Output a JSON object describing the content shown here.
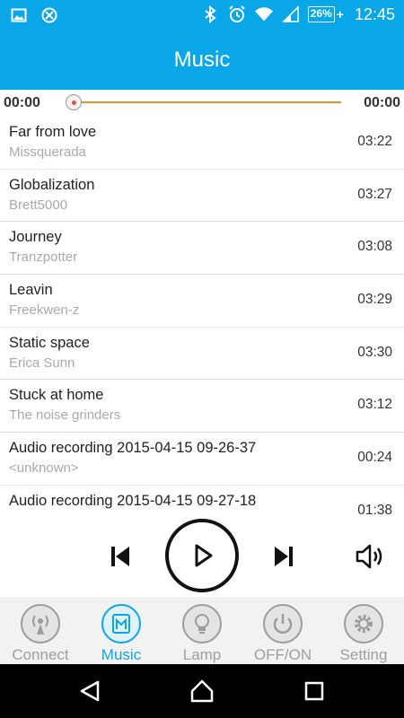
{
  "status": {
    "battery": "26%",
    "battery_plus": "+",
    "time": "12:45"
  },
  "app": {
    "title": "Music"
  },
  "player": {
    "elapsed": "00:00",
    "total": "00:00",
    "progress": 0
  },
  "tracks": [
    {
      "title": "Far from love",
      "artist": "Missquerada",
      "duration": "03:22"
    },
    {
      "title": "Globalization",
      "artist": "Brett5000",
      "duration": "03:27"
    },
    {
      "title": "Journey",
      "artist": "Tranzpotter",
      "duration": "03:08"
    },
    {
      "title": "Leavin",
      "artist": "Freekwen-z",
      "duration": "03:29"
    },
    {
      "title": "Static space",
      "artist": "Erica Sunn",
      "duration": "03:30"
    },
    {
      "title": "Stuck at home",
      "artist": "The noise grinders",
      "duration": "03:12"
    },
    {
      "title": "Audio recording 2015-04-15 09-26-37",
      "artist": "<unknown>",
      "duration": "00:24"
    },
    {
      "title": "Audio recording 2015-04-15 09-27-18",
      "artist": "",
      "duration": "01:38"
    }
  ],
  "tabs": [
    {
      "label": "Connect",
      "icon": "antenna-icon",
      "active": false
    },
    {
      "label": "Music",
      "icon": "music-icon",
      "active": true
    },
    {
      "label": "Lamp",
      "icon": "bulb-icon",
      "active": false
    },
    {
      "label": "OFF/ON",
      "icon": "power-icon",
      "active": false
    },
    {
      "label": "Setting",
      "icon": "gear-icon",
      "active": false
    }
  ],
  "colors": {
    "accent": "#0aa7e8",
    "progress": "#f08a24",
    "inactive": "#9e9e9e"
  }
}
